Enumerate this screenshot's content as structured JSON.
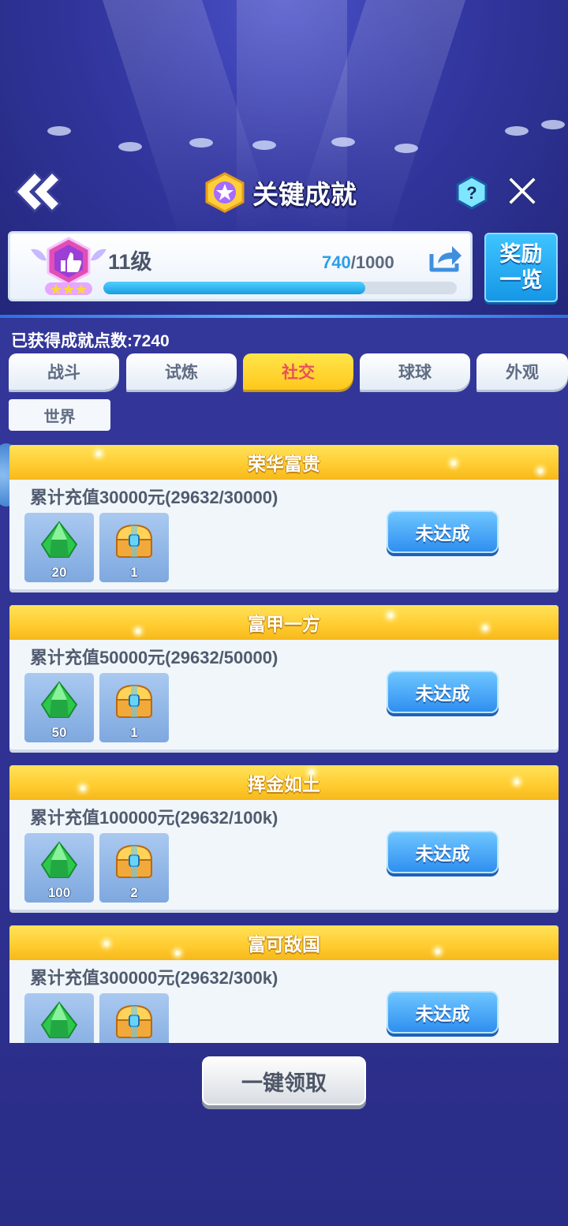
{
  "header": {
    "title": "关键成就",
    "back_icon": "double-chevron-left-icon",
    "title_icon": "star-medal-icon",
    "help_label": "?",
    "close_icon": "close-icon"
  },
  "level": {
    "label": "11级",
    "current": "740",
    "separator_max": "/1000",
    "progress_fraction": 0.74,
    "share_icon": "share-icon",
    "badge_stars": 3
  },
  "reward_list_button": "奖励一览",
  "points_label": "已获得成就点数:7240",
  "tabs": [
    {
      "label": "战斗",
      "active": false
    },
    {
      "label": "试炼",
      "active": false
    },
    {
      "label": "社交",
      "active": true
    },
    {
      "label": "球球",
      "active": false
    },
    {
      "label": "外观",
      "active": false
    }
  ],
  "sub_tab": "世界",
  "achievements": [
    {
      "title": "荣华富贵",
      "desc": "累计充值30000元(29632/30000)",
      "rewards": [
        {
          "icon": "green-gem-icon",
          "count": "20"
        },
        {
          "icon": "treasure-chest-icon",
          "count": "1"
        }
      ],
      "status": "未达成"
    },
    {
      "title": "富甲一方",
      "desc": "累计充值50000元(29632/50000)",
      "rewards": [
        {
          "icon": "green-gem-icon",
          "count": "50"
        },
        {
          "icon": "treasure-chest-icon",
          "count": "1"
        }
      ],
      "status": "未达成"
    },
    {
      "title": "挥金如土",
      "desc": "累计充值100000元(29632/100k)",
      "rewards": [
        {
          "icon": "green-gem-icon",
          "count": "100"
        },
        {
          "icon": "treasure-chest-icon",
          "count": "2"
        }
      ],
      "status": "未达成"
    },
    {
      "title": "富可敌国",
      "desc": "累计充值300000元(29632/300k)",
      "rewards": [
        {
          "icon": "green-gem-icon",
          "count": ""
        },
        {
          "icon": "treasure-chest-icon",
          "count": ""
        }
      ],
      "status": "未达成"
    }
  ],
  "claim_all_button": "一键领取",
  "colors": {
    "accent_yellow": "#ffcb2e",
    "accent_blue": "#2f8ff0",
    "active_tab_text": "#e94f5c",
    "background": "#2b2e86"
  }
}
